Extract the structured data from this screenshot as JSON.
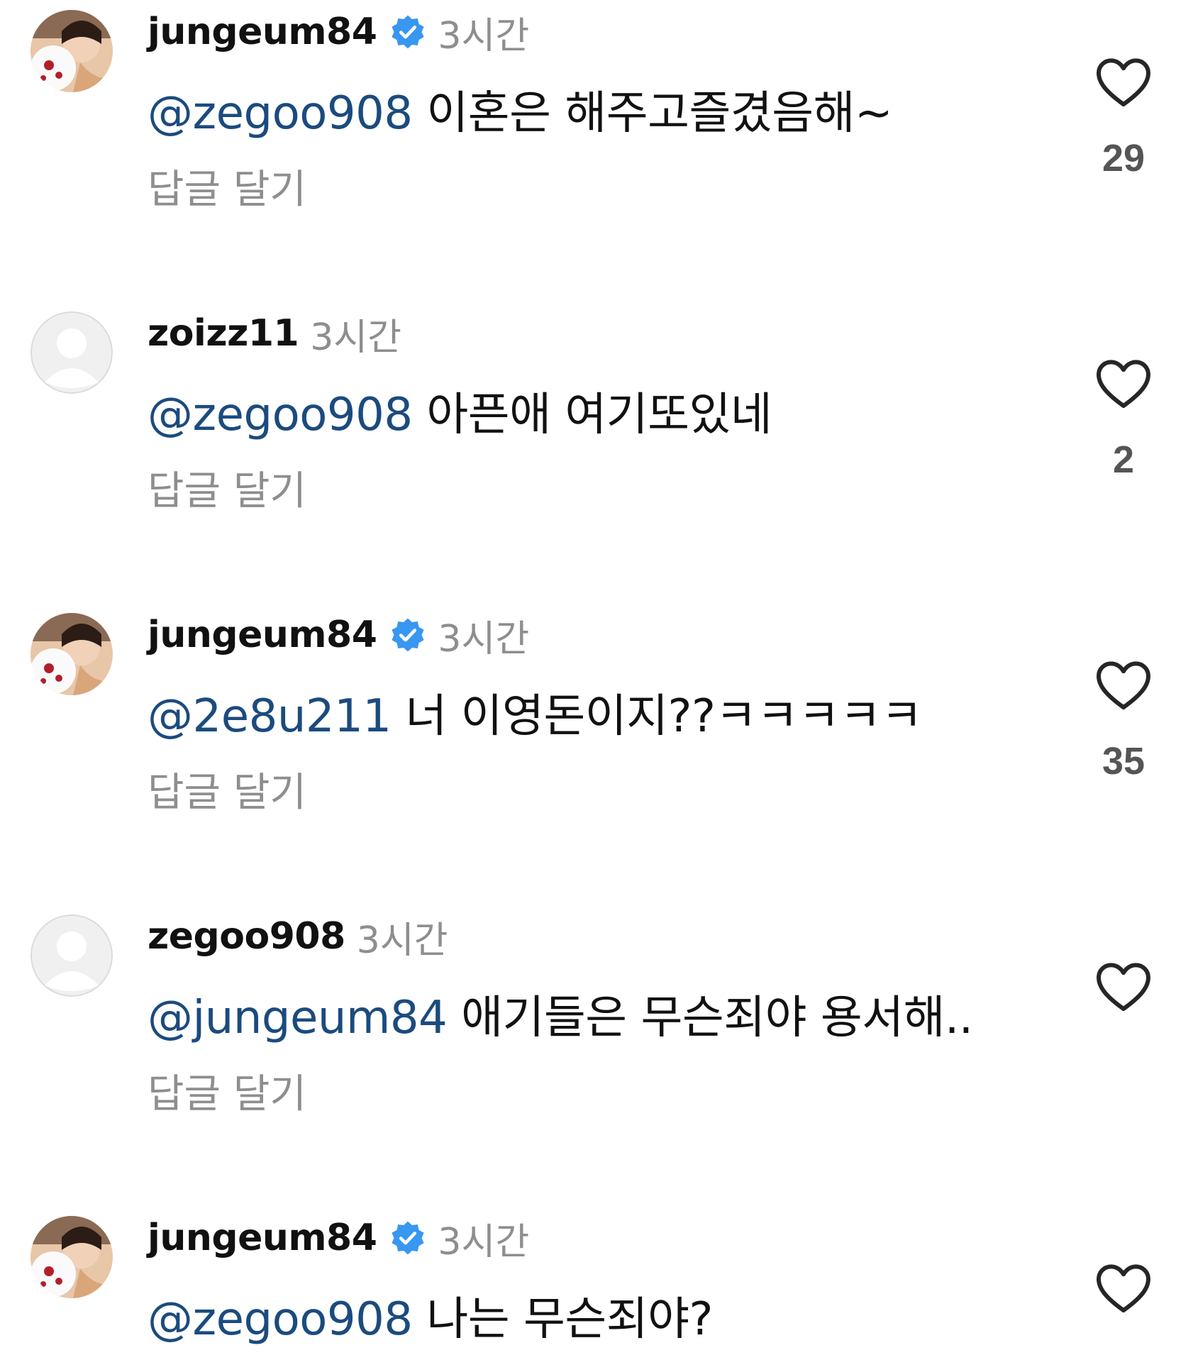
{
  "comments": [
    {
      "username": "jungeum84",
      "verified": true,
      "time": "3시간",
      "mention": "@zegoo908",
      "text": " 이혼은 해주고즐겼음해~",
      "reply_label": "답글 달기",
      "likes": "29",
      "avatar": "photo"
    },
    {
      "username": "zoizz11",
      "verified": false,
      "time": "3시간",
      "mention": "@zegoo908",
      "text": " 아픈애 여기또있네",
      "reply_label": "답글 달기",
      "likes": "2",
      "avatar": "default"
    },
    {
      "username": "jungeum84",
      "verified": true,
      "time": "3시간",
      "mention": "@2e8u211",
      "text": " 너 이영돈이지??ㅋㅋㅋㅋㅋ",
      "reply_label": "답글 달기",
      "likes": "35",
      "avatar": "photo"
    },
    {
      "username": "zegoo908",
      "verified": false,
      "time": "3시간",
      "mention": "@jungeum84",
      "text": " 애기들은 무슨죄야  용서해..",
      "reply_label": "답글 달기",
      "likes": "",
      "avatar": "default"
    },
    {
      "username": "jungeum84",
      "verified": true,
      "time": "3시간",
      "mention": "@zegoo908",
      "text": " 나는 무슨죄야?",
      "reply_label": "",
      "likes": "",
      "avatar": "photo"
    }
  ],
  "colors": {
    "mention": "#1b4b7e",
    "verified_badge": "#3897f0",
    "secondary_text": "#8e8e8e"
  }
}
